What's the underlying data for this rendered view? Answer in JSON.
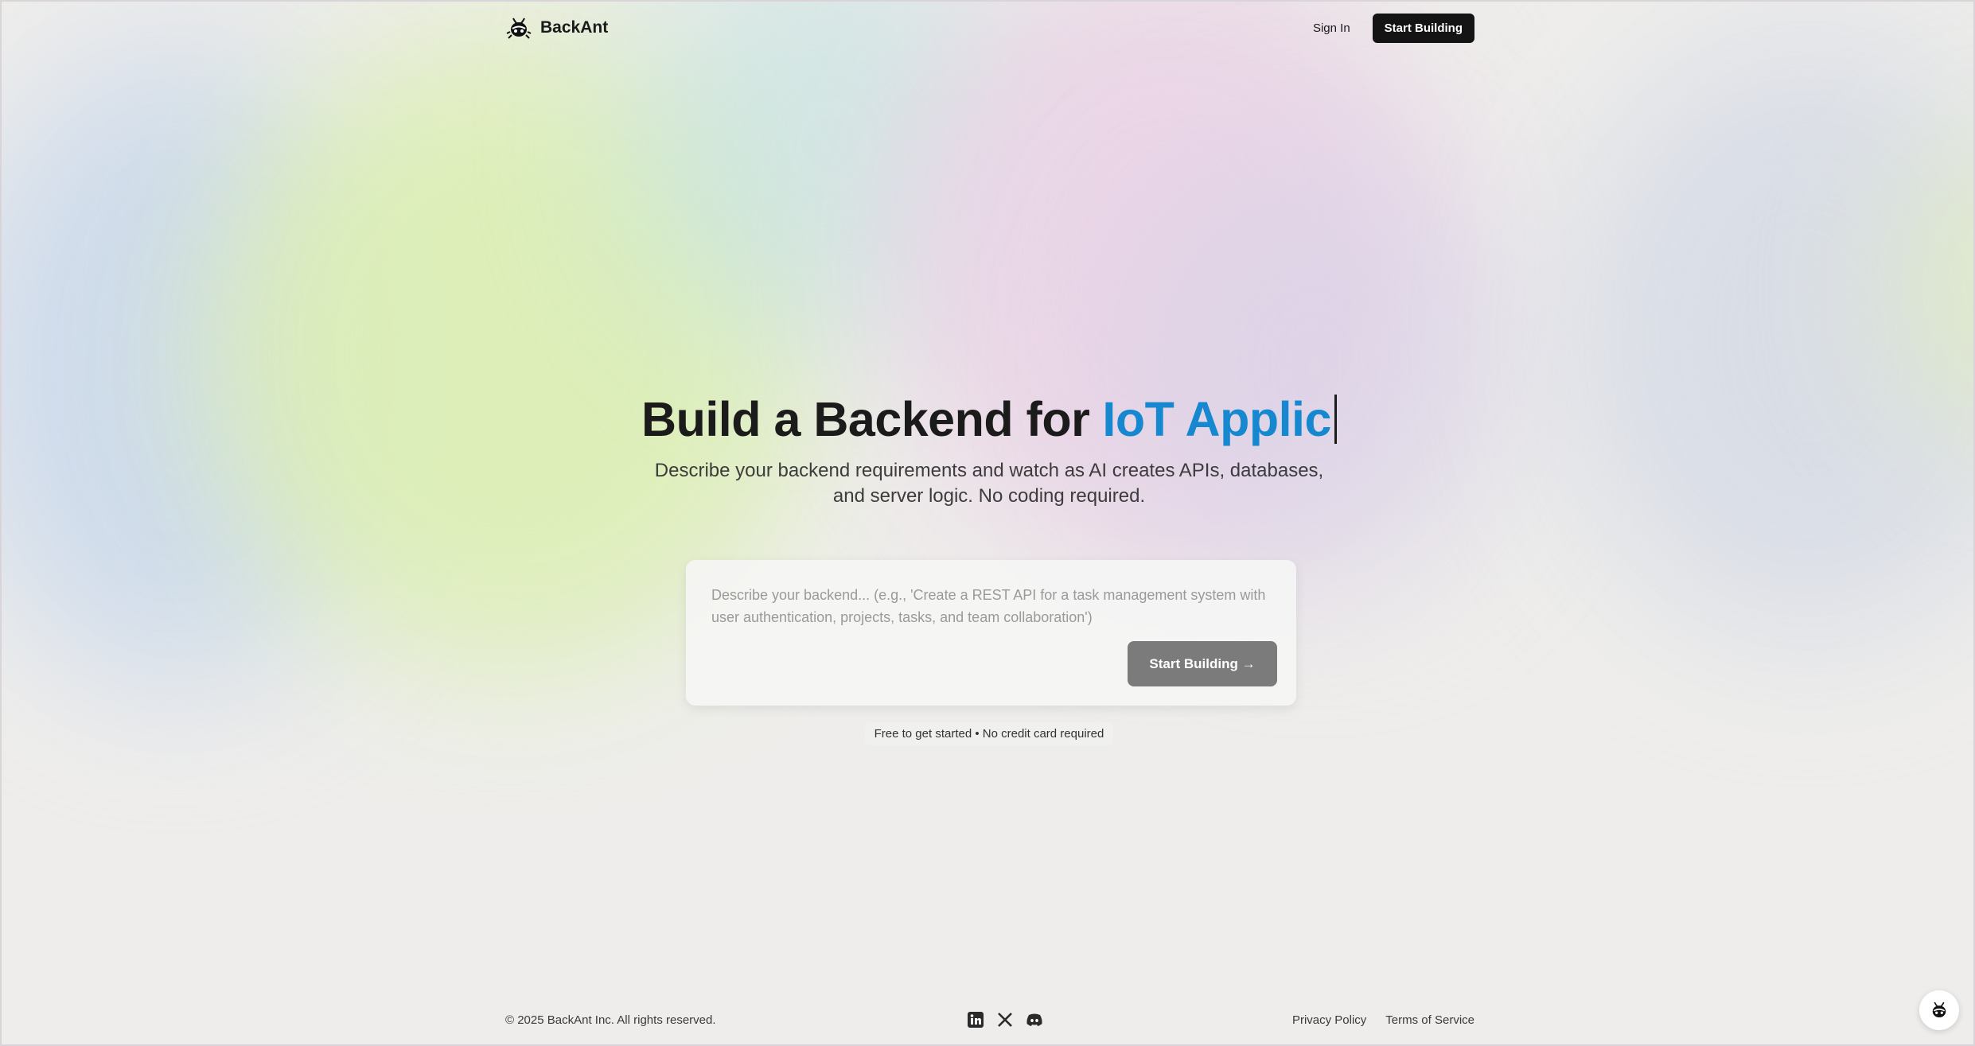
{
  "brand": {
    "name": "BackAnt",
    "logo_icon": "ant-icon"
  },
  "nav": {
    "signin_label": "Sign In",
    "cta_label": "Start Building"
  },
  "hero": {
    "title_prefix": "Build a Backend for",
    "title_accent": "IoT Applic",
    "subtitle_line1": "Describe your backend requirements and watch as AI creates APIs, databases,",
    "subtitle_line2": "and server logic. No coding required."
  },
  "prompt": {
    "placeholder": "Describe your backend... (e.g., 'Create a REST API for a task management system with user authentication, projects, tasks, and team collaboration')",
    "value": "",
    "submit_label": "Start Building →"
  },
  "note": "Free to get started • No credit card required",
  "footer": {
    "copyright": "© 2025 BackAnt Inc. All rights reserved.",
    "social": [
      "linkedin-icon",
      "x-icon",
      "discord-icon"
    ],
    "privacy_label": "Privacy Policy",
    "terms_label": "Terms of Service"
  },
  "colors": {
    "accent": "#1588cf",
    "dark_button": "#141414",
    "submit_button": "#7b7b7b"
  }
}
